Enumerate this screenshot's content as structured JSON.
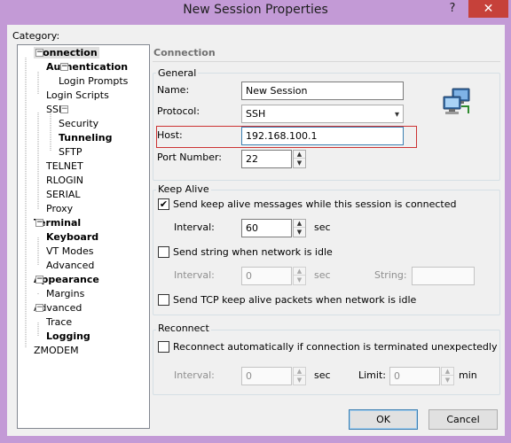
{
  "window": {
    "title": "New Session Properties",
    "help_glyph": "?",
    "close_glyph": "✕"
  },
  "category_label": "Category:",
  "tree": [
    {
      "label": "Connection",
      "bold": true,
      "selected": true,
      "expander": "−"
    },
    {
      "label": "Authentication",
      "bold": true,
      "expander": "−"
    },
    {
      "label": "Login Prompts",
      "bold": false
    },
    {
      "label": "Login Scripts",
      "bold": false
    },
    {
      "label": "SSH",
      "bold": false,
      "expander": "−"
    },
    {
      "label": "Security",
      "bold": false
    },
    {
      "label": "Tunneling",
      "bold": true
    },
    {
      "label": "SFTP",
      "bold": false
    },
    {
      "label": "TELNET",
      "bold": false
    },
    {
      "label": "RLOGIN",
      "bold": false
    },
    {
      "label": "SERIAL",
      "bold": false
    },
    {
      "label": "Proxy",
      "bold": false
    },
    {
      "label": "Terminal",
      "bold": true,
      "expander": "−"
    },
    {
      "label": "Keyboard",
      "bold": true
    },
    {
      "label": "VT Modes",
      "bold": false
    },
    {
      "label": "Advanced",
      "bold": false
    },
    {
      "label": "Appearance",
      "bold": true,
      "expander": "−"
    },
    {
      "label": "Margins",
      "bold": false
    },
    {
      "label": "Advanced",
      "bold": false,
      "expander": "−"
    },
    {
      "label": "Trace",
      "bold": false
    },
    {
      "label": "Logging",
      "bold": true
    },
    {
      "label": "ZMODEM",
      "bold": false
    }
  ],
  "panel_header": "Connection",
  "general": {
    "title": "General",
    "name_label": "Name:",
    "name_value": "New Session",
    "protocol_label": "Protocol:",
    "protocol_value": "SSH",
    "host_label": "Host:",
    "host_value": "192.168.100.1",
    "port_label": "Port Number:",
    "port_value": "22"
  },
  "keep_alive": {
    "title": "Keep Alive",
    "send_keep_alive_label": "Send keep alive messages while this session is connected",
    "send_keep_alive_checked": true,
    "interval_label": "Interval:",
    "interval_value": "60",
    "sec_label": "sec",
    "send_string_label": "Send string when network is idle",
    "send_string_checked": false,
    "string_interval_label": "Interval:",
    "string_interval_value": "0",
    "string_sec_label": "sec",
    "string_label": "String:",
    "string_value": "",
    "tcp_keep_alive_label": "Send TCP keep alive packets when network is idle",
    "tcp_keep_alive_checked": false
  },
  "reconnect": {
    "title": "Reconnect",
    "auto_label": "Reconnect automatically if connection is terminated unexpectedly",
    "auto_checked": false,
    "interval_label": "Interval:",
    "interval_value": "0",
    "sec_label": "sec",
    "limit_label": "Limit:",
    "limit_value": "0",
    "min_label": "min"
  },
  "buttons": {
    "ok": "OK",
    "cancel": "Cancel"
  },
  "icons": {
    "up_arrow": "▲",
    "down_arrow": "▼",
    "combo_arrow": "▾",
    "check": "✔"
  },
  "colors": {
    "window_frame": "#c39ad6",
    "close_button": "#c6413a",
    "highlight_border": "#cc3333"
  }
}
